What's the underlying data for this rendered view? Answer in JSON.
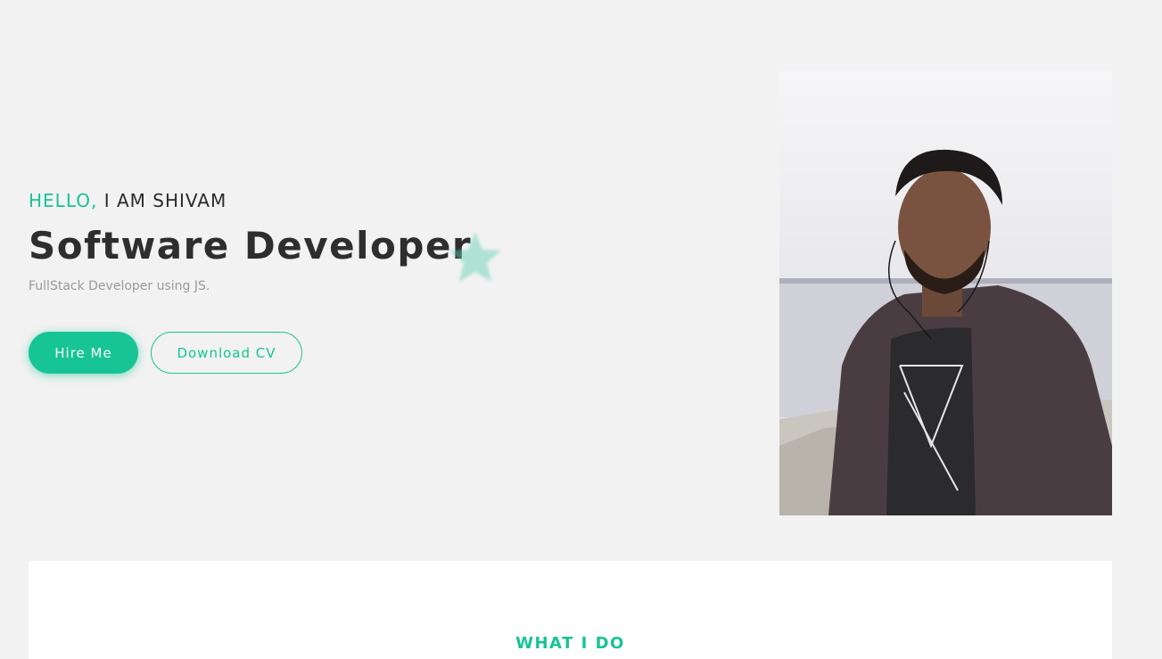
{
  "hero": {
    "greeting_accent": "HELLO,",
    "greeting_rest": " I AM SHIVAM",
    "title": "Software Developer",
    "subtitle": "FullStack Developer using JS.",
    "primary_button": "Hire Me",
    "secondary_button": "Download CV"
  },
  "services": {
    "heading": "WHAT I DO"
  },
  "colors": {
    "accent": "#17c495",
    "background": "#f2f2f2",
    "heading_text": "#2e2e2e",
    "muted_text": "#9a9a9a"
  },
  "icons": {
    "decoration": "star-icon"
  }
}
